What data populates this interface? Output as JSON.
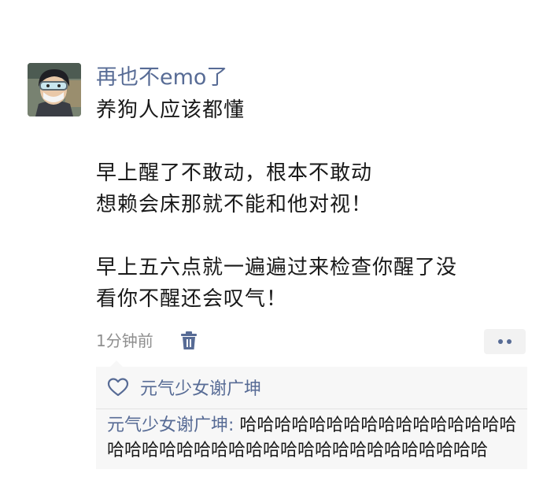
{
  "post": {
    "author": "再也不emo了",
    "lines": [
      "养狗人应该都懂",
      "",
      "早上醒了不敢动，根本不敢动",
      "想赖会床那就不能和他对视！",
      "",
      "早上五六点就一遍遍过来检查你醒了没",
      "看你不醒还会叹气！"
    ],
    "time": "1分钟前"
  },
  "interactions": {
    "likes": "元气少女谢广坤",
    "comments": [
      {
        "author": "元气少女谢广坤",
        "separator": ": ",
        "text": "哈哈哈哈哈哈哈哈哈哈哈哈哈哈哈哈哈哈哈哈哈哈哈哈哈哈哈哈哈哈哈哈哈哈哈哈哈哈"
      }
    ]
  },
  "icons": {
    "trash": "trash-icon",
    "more": "more-dots-icon",
    "like": "heart-outline-icon"
  },
  "colors": {
    "link": "#576b95",
    "text": "#191919",
    "muted": "#8f8f8f",
    "panel": "#f7f7f7"
  }
}
